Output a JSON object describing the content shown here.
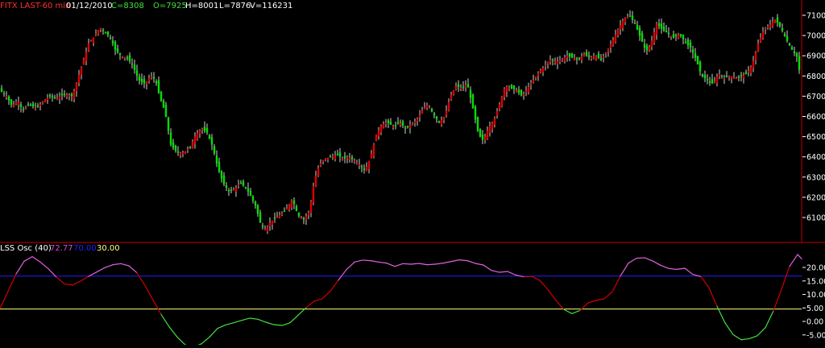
{
  "price_header": {
    "symbol": "FITX LAST-60 min",
    "date": "01/12/2010",
    "close": "C=8308",
    "open": "O=7925",
    "high": "H=8001",
    "low": "L=7876",
    "volume": "V=116231"
  },
  "osc_header": {
    "name": "LSS Osc (40)",
    "value": "72.77",
    "level_high": "70.00",
    "level_low": "30.00"
  },
  "colors": {
    "background": "#000000",
    "up_candle": "#e00000",
    "down_candle": "#00e000",
    "divider": "#c00000",
    "axis_text": "#ffffff",
    "symbol_text": "#ff3030",
    "close_text": "#40e040",
    "open_text": "#40e040",
    "osc_value_text": "#d050d0",
    "level_high_line": "#2020ff",
    "level_low_line": "#ffff80",
    "osc_overbought": "#e060e0",
    "osc_middle": "#d00000",
    "osc_oversold": "#40e040"
  },
  "chart_data": [
    {
      "type": "candlestick",
      "title": "FITX LAST-60 min",
      "ylim": [
        6000,
        7150
      ],
      "y_ticks": [
        "7100",
        "7000",
        "6900",
        "6800",
        "6700",
        "6600",
        "6500",
        "6400",
        "6300",
        "6200",
        "6100"
      ],
      "grid": false,
      "price_path": [
        [
          0,
          6730
        ],
        [
          8,
          6700
        ],
        [
          15,
          6650
        ],
        [
          22,
          6680
        ],
        [
          28,
          6630
        ],
        [
          36,
          6660
        ],
        [
          45,
          6640
        ],
        [
          55,
          6680
        ],
        [
          62,
          6700
        ],
        [
          70,
          6690
        ],
        [
          80,
          6710
        ],
        [
          90,
          6700
        ],
        [
          96,
          6780
        ],
        [
          103,
          6870
        ],
        [
          110,
          6960
        ],
        [
          118,
          7000
        ],
        [
          124,
          7040
        ],
        [
          130,
          7020
        ],
        [
          137,
          6990
        ],
        [
          143,
          6930
        ],
        [
          150,
          6900
        ],
        [
          158,
          6890
        ],
        [
          165,
          6850
        ],
        [
          172,
          6780
        ],
        [
          180,
          6760
        ],
        [
          187,
          6800
        ],
        [
          193,
          6780
        ],
        [
          198,
          6700
        ],
        [
          205,
          6620
        ],
        [
          212,
          6460
        ],
        [
          220,
          6420
        ],
        [
          228,
          6420
        ],
        [
          236,
          6450
        ],
        [
          243,
          6510
        ],
        [
          250,
          6540
        ],
        [
          257,
          6520
        ],
        [
          264,
          6450
        ],
        [
          270,
          6350
        ],
        [
          277,
          6270
        ],
        [
          284,
          6230
        ],
        [
          291,
          6240
        ],
        [
          298,
          6270
        ],
        [
          305,
          6250
        ],
        [
          312,
          6200
        ],
        [
          318,
          6150
        ],
        [
          324,
          6060
        ],
        [
          330,
          6040
        ],
        [
          336,
          6080
        ],
        [
          343,
          6100
        ],
        [
          350,
          6120
        ],
        [
          357,
          6150
        ],
        [
          363,
          6190
        ],
        [
          370,
          6110
        ],
        [
          377,
          6090
        ],
        [
          384,
          6130
        ],
        [
          390,
          6280
        ],
        [
          396,
          6360
        ],
        [
          403,
          6390
        ],
        [
          410,
          6400
        ],
        [
          418,
          6410
        ],
        [
          426,
          6390
        ],
        [
          433,
          6400
        ],
        [
          440,
          6380
        ],
        [
          447,
          6360
        ],
        [
          453,
          6330
        ],
        [
          460,
          6400
        ],
        [
          467,
          6510
        ],
        [
          474,
          6560
        ],
        [
          481,
          6570
        ],
        [
          488,
          6550
        ],
        [
          496,
          6570
        ],
        [
          503,
          6540
        ],
        [
          510,
          6560
        ],
        [
          517,
          6580
        ],
        [
          524,
          6630
        ],
        [
          531,
          6660
        ],
        [
          538,
          6610
        ],
        [
          545,
          6570
        ],
        [
          552,
          6600
        ],
        [
          559,
          6700
        ],
        [
          566,
          6750
        ],
        [
          573,
          6740
        ],
        [
          580,
          6760
        ],
        [
          587,
          6640
        ],
        [
          594,
          6510
        ],
        [
          600,
          6480
        ],
        [
          606,
          6540
        ],
        [
          613,
          6580
        ],
        [
          620,
          6660
        ],
        [
          627,
          6750
        ],
        [
          634,
          6740
        ],
        [
          641,
          6730
        ],
        [
          648,
          6700
        ],
        [
          655,
          6740
        ],
        [
          662,
          6780
        ],
        [
          669,
          6820
        ],
        [
          676,
          6850
        ],
        [
          683,
          6880
        ],
        [
          690,
          6870
        ],
        [
          697,
          6880
        ],
        [
          704,
          6900
        ],
        [
          711,
          6890
        ],
        [
          718,
          6880
        ],
        [
          725,
          6910
        ],
        [
          732,
          6890
        ],
        [
          739,
          6900
        ],
        [
          746,
          6880
        ],
        [
          753,
          6920
        ],
        [
          760,
          6970
        ],
        [
          767,
          7030
        ],
        [
          774,
          7080
        ],
        [
          781,
          7100
        ],
        [
          788,
          7060
        ],
        [
          795,
          6990
        ],
        [
          802,
          6920
        ],
        [
          808,
          6960
        ],
        [
          815,
          7060
        ],
        [
          822,
          7030
        ],
        [
          829,
          7010
        ],
        [
          836,
          6990
        ],
        [
          843,
          7010
        ],
        [
          850,
          6970
        ],
        [
          857,
          6940
        ],
        [
          864,
          6880
        ],
        [
          871,
          6800
        ],
        [
          878,
          6780
        ],
        [
          885,
          6760
        ],
        [
          892,
          6810
        ],
        [
          899,
          6790
        ],
        [
          906,
          6800
        ],
        [
          913,
          6790
        ],
        [
          920,
          6800
        ],
        [
          927,
          6810
        ],
        [
          934,
          6860
        ],
        [
          941,
          6960
        ],
        [
          948,
          7030
        ],
        [
          955,
          7050
        ],
        [
          962,
          7080
        ],
        [
          969,
          7040
        ],
        [
          976,
          6980
        ],
        [
          983,
          6930
        ],
        [
          990,
          6890
        ],
        [
          995,
          6740
        ]
      ]
    },
    {
      "type": "line",
      "title": "LSS Osc (40)",
      "ylim": [
        -10,
        25
      ],
      "y_ticks": [
        "20.00",
        "15.00",
        "10.00",
        "5.00",
        "0.00",
        "-5.00"
      ],
      "grid": false,
      "levels": [
        70,
        30
      ],
      "thresholds": {
        "overbought_above": 16.8,
        "oversold_below": 4.6
      },
      "x": [
        0,
        10,
        20,
        30,
        40,
        50,
        60,
        70,
        80,
        90,
        100,
        110,
        120,
        130,
        140,
        150,
        160,
        170,
        180,
        190,
        200,
        210,
        220,
        230,
        240,
        250,
        260,
        270,
        280,
        290,
        300,
        310,
        320,
        330,
        340,
        350,
        360,
        370,
        380,
        390,
        400,
        410,
        420,
        430,
        440,
        450,
        460,
        470,
        480,
        490,
        500,
        510,
        520,
        530,
        540,
        550,
        560,
        570,
        580,
        590,
        600,
        610,
        620,
        630,
        640,
        650,
        660,
        670,
        680,
        690,
        700,
        710,
        720,
        730,
        740,
        750,
        760,
        770,
        780,
        790,
        800,
        810,
        820,
        830,
        840,
        850,
        860,
        870,
        880,
        890,
        900,
        910,
        920,
        930,
        940,
        950,
        960,
        970,
        980,
        990,
        995
      ],
      "values": [
        4.8,
        11.2,
        17.6,
        22.3,
        24.0,
        22.0,
        19.5,
        16.4,
        13.9,
        13.5,
        14.9,
        16.7,
        18.3,
        19.9,
        21.0,
        21.4,
        20.6,
        18.0,
        13.3,
        7.9,
        2.6,
        -2.0,
        -5.8,
        -8.7,
        -9.5,
        -8.3,
        -5.8,
        -2.6,
        -1.3,
        -0.5,
        0.4,
        1.2,
        0.8,
        -0.3,
        -1.2,
        -1.5,
        -0.5,
        2.3,
        5.1,
        7.5,
        8.4,
        11.2,
        15.3,
        19.2,
        22.0,
        22.7,
        22.5,
        22.0,
        21.6,
        20.4,
        21.4,
        21.2,
        21.5,
        21.0,
        21.2,
        21.6,
        22.2,
        22.8,
        22.5,
        21.5,
        20.9,
        18.9,
        18.2,
        18.5,
        17.2,
        16.5,
        16.7,
        15.2,
        11.8,
        7.8,
        4.4,
        2.9,
        4.1,
        6.9,
        7.8,
        8.4,
        11.0,
        16.8,
        21.6,
        23.4,
        23.6,
        22.4,
        20.8,
        19.6,
        19.3,
        19.7,
        17.4,
        16.6,
        12.5,
        5.6,
        -0.6,
        -4.9,
        -6.8,
        -6.4,
        -5.3,
        -2.3,
        3.9,
        11.9,
        20.4,
        24.8,
        23.2,
        20.1
      ]
    }
  ]
}
